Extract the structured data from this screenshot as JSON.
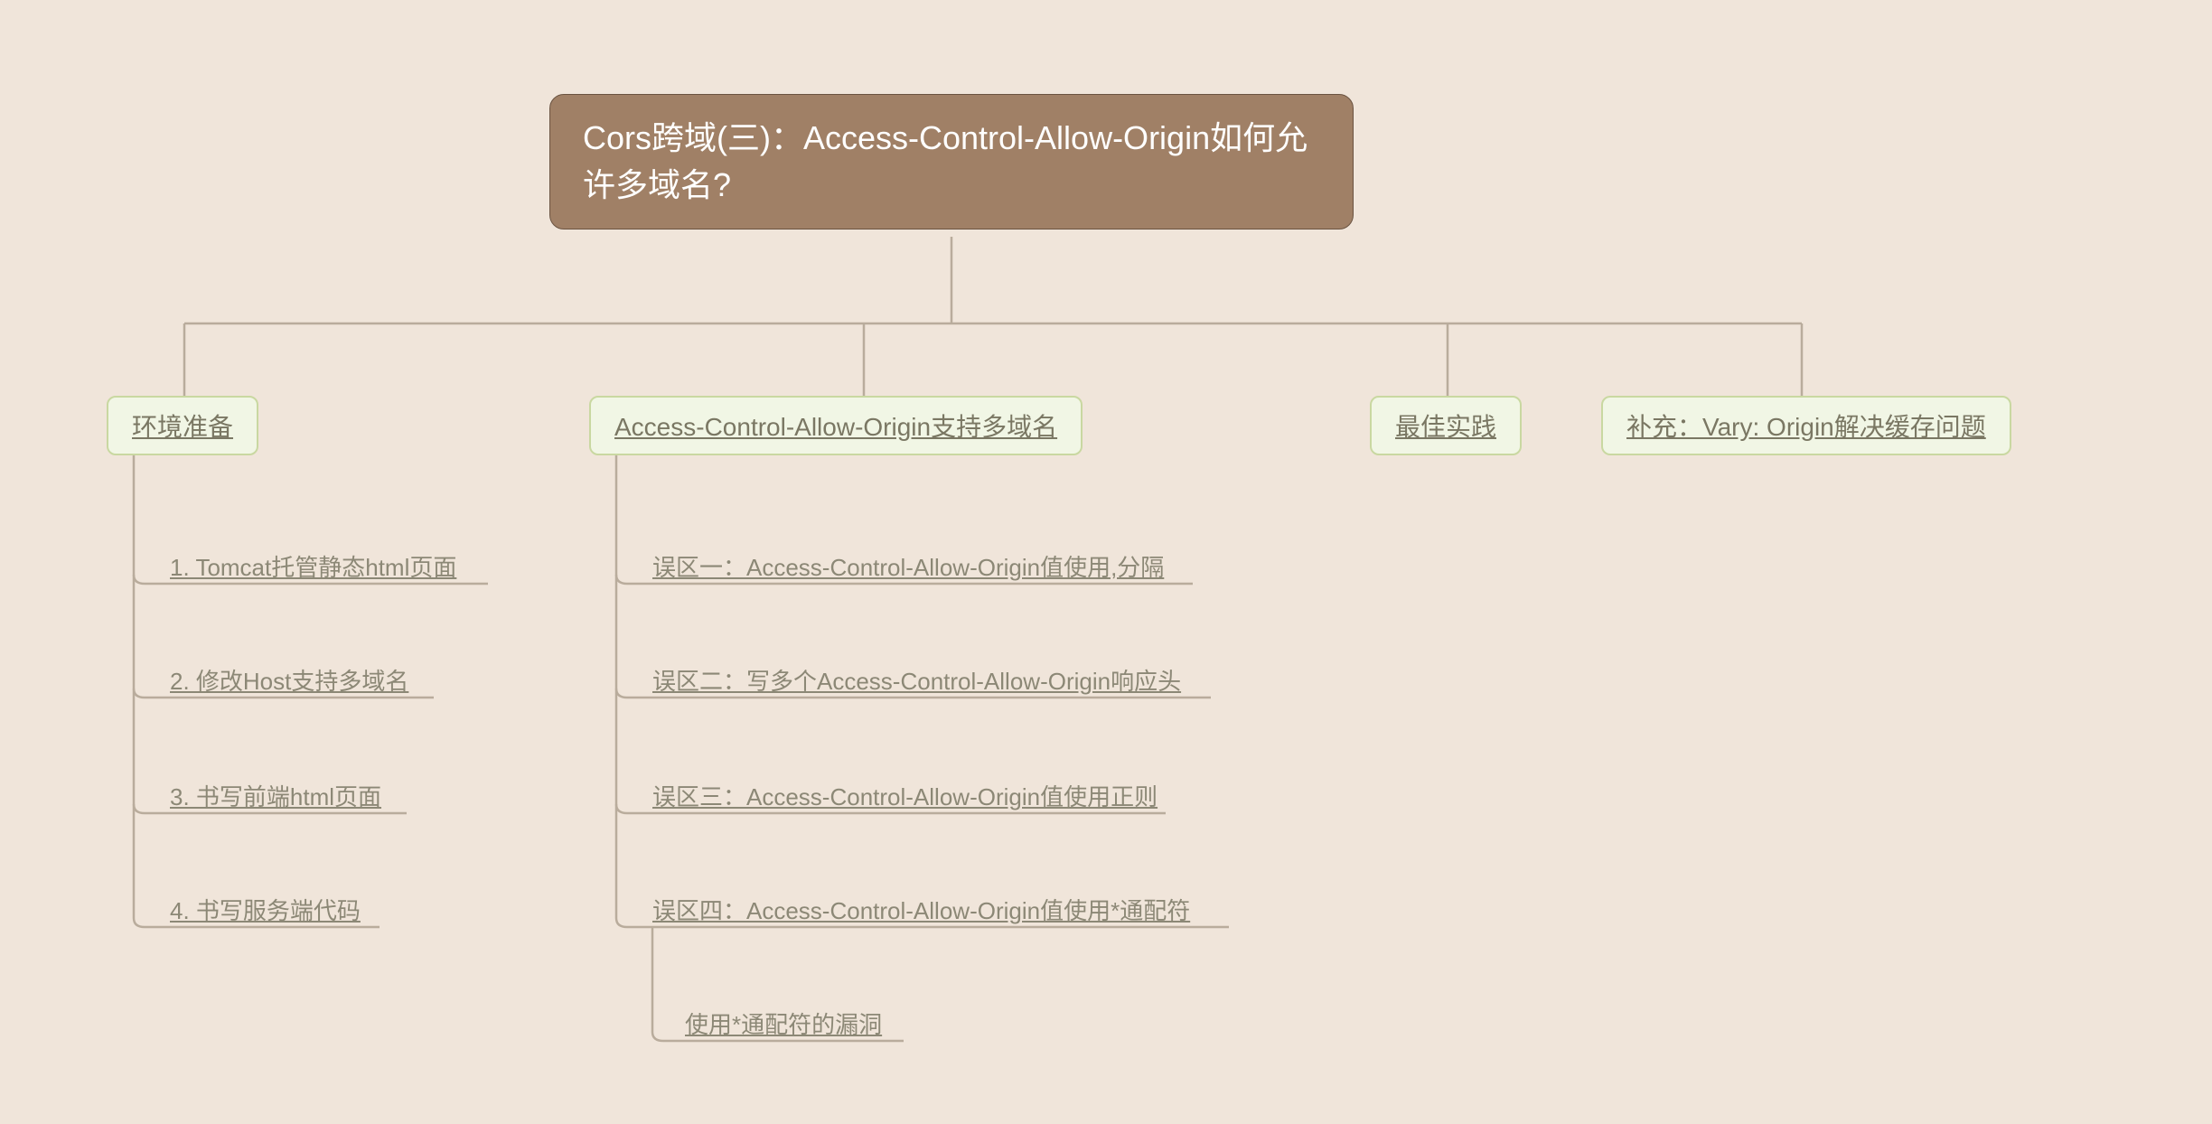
{
  "root": {
    "title": "Cors跨域(三)：Access-Control-Allow-Origin如何允许多域名?"
  },
  "branches": [
    {
      "label": "环境准备"
    },
    {
      "label": "Access-Control-Allow-Origin支持多域名"
    },
    {
      "label": "最佳实践"
    },
    {
      "label": "补充：Vary: Origin解决缓存问题"
    }
  ],
  "env_children": [
    {
      "label": "1. Tomcat托管静态html页面"
    },
    {
      "label": "2. 修改Host支持多域名"
    },
    {
      "label": "3. 书写前端html页面"
    },
    {
      "label": "4. 书写服务端代码"
    }
  ],
  "acao_children": [
    {
      "label": "误区一：Access-Control-Allow-Origin值使用,分隔"
    },
    {
      "label": "误区二：写多个Access-Control-Allow-Origin响应头"
    },
    {
      "label": "误区三：Access-Control-Allow-Origin值使用正则"
    },
    {
      "label": "误区四：Access-Control-Allow-Origin值使用*通配符"
    }
  ],
  "wildcard_child": {
    "label": "使用*通配符的漏洞"
  }
}
